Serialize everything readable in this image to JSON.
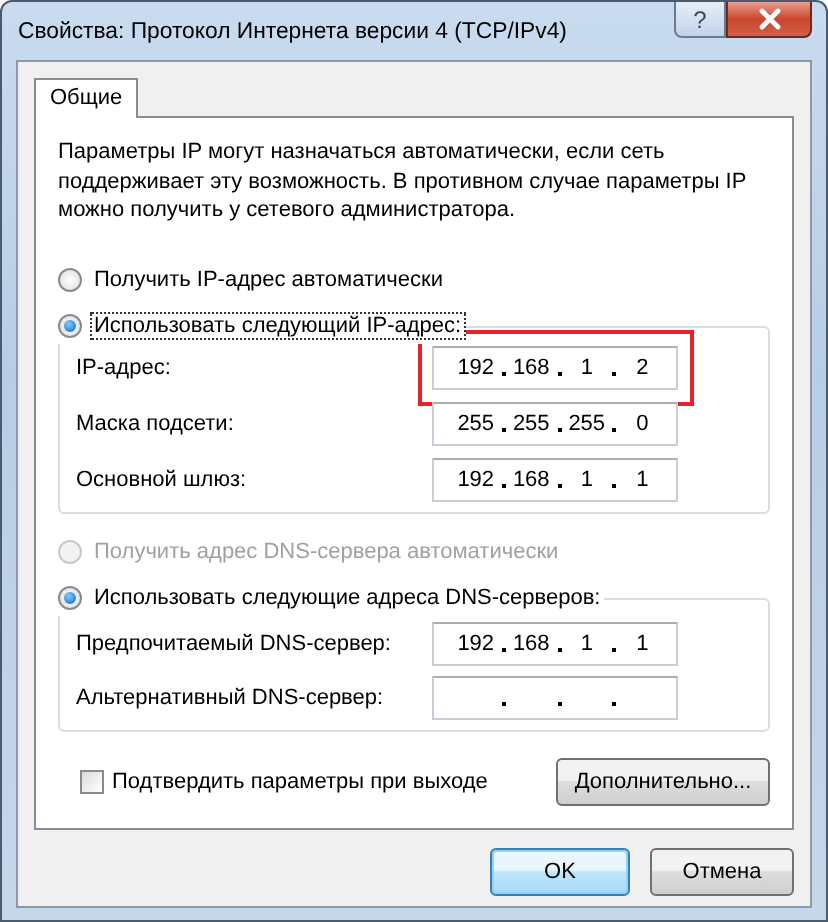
{
  "window": {
    "title": "Свойства: Протокол Интернета версии 4 (TCP/IPv4)",
    "help_button": "?"
  },
  "tabs": [
    {
      "label": "Общие",
      "selected": true
    }
  ],
  "description": "Параметры IP могут назначаться автоматически, если сеть поддерживает эту возможность. В противном случае параметры IP можно получить у сетевого администратора.",
  "ip_mode": [
    {
      "label": "Получить IP-адрес автоматически",
      "selected": false,
      "disabled": false,
      "focused": false
    },
    {
      "label": "Использовать следующий IP-адрес:",
      "selected": true,
      "disabled": false,
      "focused": true
    }
  ],
  "ip_fields": [
    {
      "label": "IP-адрес:",
      "octets": [
        "192",
        "168",
        "1",
        "2"
      ],
      "highlighted": true
    },
    {
      "label": "Маска подсети:",
      "octets": [
        "255",
        "255",
        "255",
        "0"
      ],
      "highlighted": false
    },
    {
      "label": "Основной шлюз:",
      "octets": [
        "192",
        "168",
        "1",
        "1"
      ],
      "highlighted": false
    }
  ],
  "dns_mode": [
    {
      "label": "Получить адрес DNS-сервера автоматически",
      "selected": false,
      "disabled": true,
      "focused": false
    },
    {
      "label": "Использовать следующие адреса DNS-серверов:",
      "selected": true,
      "disabled": false,
      "focused": false
    }
  ],
  "dns_fields": [
    {
      "label": "Предпочитаемый DNS-сервер:",
      "octets": [
        "192",
        "168",
        "1",
        "1"
      ],
      "highlighted": false
    },
    {
      "label": "Альтернативный DNS-сервер:",
      "highlighted": false
    }
  ],
  "validate_on_exit": {
    "label": "Подтвердить параметры при выходе",
    "checked": false
  },
  "advanced_button": "Дополнительно...",
  "buttons": [
    {
      "label": "OK",
      "default": true
    },
    {
      "label": "Отмена",
      "default": false
    }
  ]
}
